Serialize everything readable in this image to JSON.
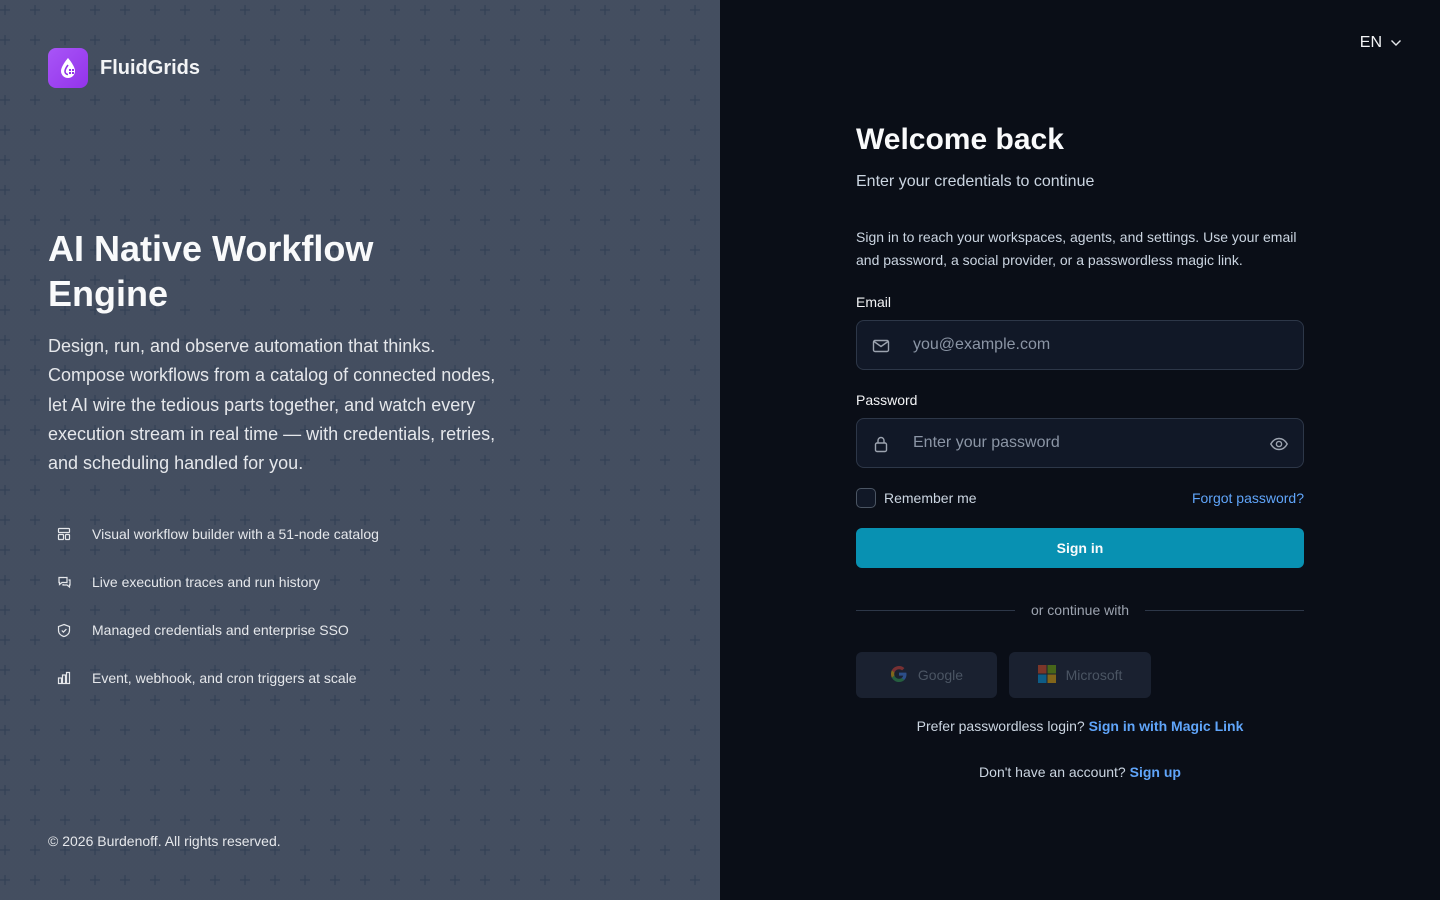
{
  "brand": {
    "name": "FluidGrids"
  },
  "hero": {
    "title": "AI Native Workflow Engine",
    "description": "Design, run, and observe automation that thinks. Compose workflows from a catalog of connected nodes, let AI wire the tedious parts together, and watch every execution stream in real time — with credentials, retries, and scheduling handled for you."
  },
  "features": [
    {
      "icon": "layout-grid-icon",
      "label": "Visual workflow builder with a 51-node catalog"
    },
    {
      "icon": "chat-bubbles-icon",
      "label": "Live execution traces and run history"
    },
    {
      "icon": "shield-check-icon",
      "label": "Managed credentials and enterprise SSO"
    },
    {
      "icon": "bar-chart-icon",
      "label": "Event, webhook, and cron triggers at scale"
    }
  ],
  "footer": {
    "copyright": "© 2026 Burdenoff. All rights reserved."
  },
  "language": {
    "selected": "EN"
  },
  "login": {
    "title": "Welcome back",
    "subtitle": "Enter your credentials to continue",
    "intro": "Sign in to reach your workspaces, agents, and settings. Use your email and password, a social provider, or a passwordless magic link.",
    "email_label": "Email",
    "email_placeholder": "you@example.com",
    "password_label": "Password",
    "password_placeholder": "Enter your password",
    "remember_label": "Remember me",
    "forgot_label": "Forgot password?",
    "signin_label": "Sign in",
    "divider_label": "or continue with",
    "google_label": "Google",
    "microsoft_label": "Microsoft",
    "magic_prompt": "Prefer passwordless login?",
    "magic_link": "Sign in with Magic Link",
    "signup_prompt": "Don't have an account?",
    "signup_link": "Sign up"
  },
  "colors": {
    "accent": "#0891b2",
    "link": "#60a5fa",
    "brand": "#a855f7",
    "left_bg": "#111827",
    "right_bg": "#0a0e17"
  }
}
